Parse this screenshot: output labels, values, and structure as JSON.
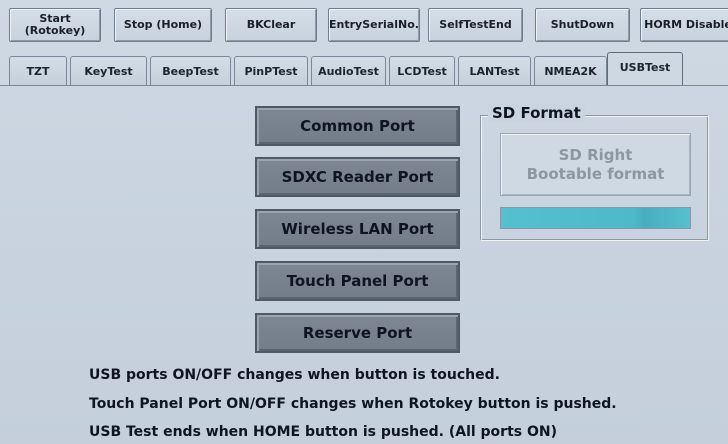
{
  "toolbar": {
    "buttons": [
      {
        "label": "Start\n(Rotokey)"
      },
      {
        "label": "Stop (Home)"
      },
      {
        "label": "BKClear"
      },
      {
        "label": "EntrySerialNo."
      },
      {
        "label": "SelfTestEnd"
      },
      {
        "label": "ShutDown"
      },
      {
        "label": "HORM Disable"
      }
    ]
  },
  "tabs": [
    {
      "label": "TZT"
    },
    {
      "label": "KeyTest"
    },
    {
      "label": "BeepTest"
    },
    {
      "label": "PinPTest"
    },
    {
      "label": "AudioTest"
    },
    {
      "label": "LCDTest"
    },
    {
      "label": "LANTest"
    },
    {
      "label": "NMEA2K"
    },
    {
      "label": "USBTest",
      "active": true
    }
  ],
  "ports": [
    {
      "label": "Common Port"
    },
    {
      "label": "SDXC Reader Port"
    },
    {
      "label": "Wireless LAN Port"
    },
    {
      "label": "Touch Panel Port"
    },
    {
      "label": "Reserve Port"
    }
  ],
  "sd_format": {
    "title": "SD Format",
    "button_label": "SD Right\nBootable format",
    "progress": 1.0,
    "progress_color": "#55c0cf"
  },
  "info_lines": [
    "USB ports ON/OFF changes when button is touched.",
    "Touch Panel Port ON/OFF changes when Rotokey button is pushed.",
    "USB Test ends when HOME button is pushed. (All ports ON)"
  ],
  "colors": {
    "background": "#c9d4e0",
    "port_button": "#7a8491",
    "text": "#0e1420"
  }
}
